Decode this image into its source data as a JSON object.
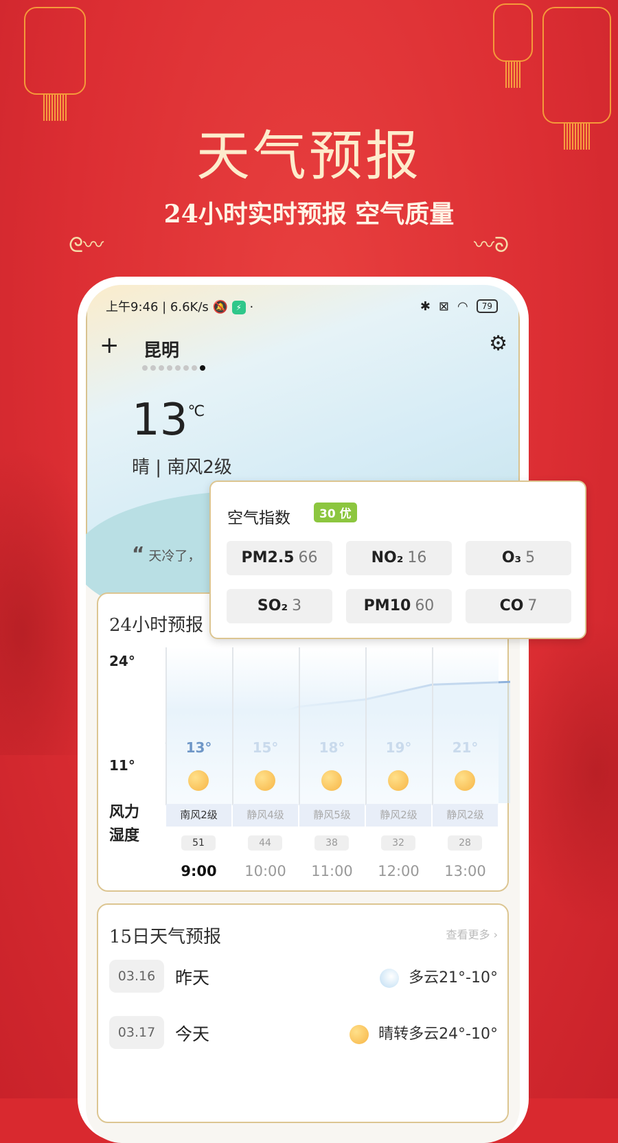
{
  "hero": {
    "title": "天气预报",
    "subtitle": "24小时实时预报 空气质量"
  },
  "status_bar": {
    "time": "上午9:46 | 6.6K/s",
    "dot": "·",
    "battery": "79"
  },
  "header": {
    "city": "昆明",
    "page_count": 8,
    "active_page": 8
  },
  "current": {
    "temperature": "13",
    "unit": "℃",
    "condition": "晴 | 南风2级",
    "quote": "天冷了，"
  },
  "air": {
    "title": "空气指数",
    "badge": "30 优",
    "badge_color": "#8cc63f",
    "items": [
      {
        "name": "PM2.5",
        "value": "66"
      },
      {
        "name": "NO₂",
        "value": "16"
      },
      {
        "name": "O₃",
        "value": "5"
      },
      {
        "name": "SO₂",
        "value": "3"
      },
      {
        "name": "PM10",
        "value": "60"
      },
      {
        "name": "CO",
        "value": "7"
      }
    ]
  },
  "hourly": {
    "title": "24小时预报",
    "y_max": "24°",
    "y_min": "11°",
    "wind_label": "风力",
    "humidity_label": "湿度",
    "chart_data": {
      "type": "line",
      "ylim": [
        11,
        24
      ],
      "items": [
        {
          "time": "9:00",
          "temp": 13,
          "temp_label": "13°",
          "wind": "南风2级",
          "humidity": "51",
          "icon": "sun-icon"
        },
        {
          "time": "10:00",
          "temp": 15,
          "temp_label": "15°",
          "wind": "静风4级",
          "humidity": "44",
          "icon": "sun-icon"
        },
        {
          "time": "11:00",
          "temp": 18,
          "temp_label": "18°",
          "wind": "静风5级",
          "humidity": "38",
          "icon": "sun-icon"
        },
        {
          "time": "12:00",
          "temp": 19,
          "temp_label": "19°",
          "wind": "静风2级",
          "humidity": "32",
          "icon": "sun-icon"
        },
        {
          "time": "13:00",
          "temp": 21,
          "temp_label": "21°",
          "wind": "静风2级",
          "humidity": "28",
          "icon": "sun-icon"
        }
      ]
    }
  },
  "daily": {
    "title": "15日天气预报",
    "more": "查看更多 ›",
    "rows": [
      {
        "date": "03.16",
        "day": "昨天",
        "icon": "cloudy-icon",
        "forecast": "多云21°-10°"
      },
      {
        "date": "03.17",
        "day": "今天",
        "icon": "sun-icon",
        "forecast": "晴转多云24°-10°"
      }
    ]
  }
}
